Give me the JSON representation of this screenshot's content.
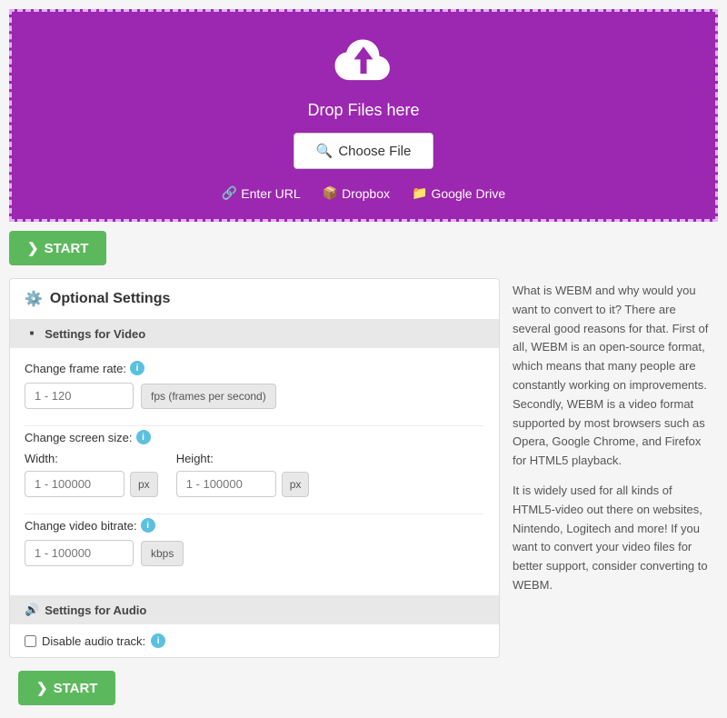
{
  "dropzone": {
    "drop_text": "Drop Files here",
    "choose_file_label": "Choose File",
    "enter_url_label": "Enter URL",
    "dropbox_label": "Dropbox",
    "google_drive_label": "Google Drive",
    "bg_color": "#9c27b0",
    "border_color": "#e0b0ff"
  },
  "start_button": {
    "label": "START"
  },
  "settings": {
    "title": "Optional Settings",
    "video_section": {
      "header": "Settings for Video",
      "frame_rate": {
        "label": "Change frame rate:",
        "placeholder": "1 - 120",
        "unit": "fps (frames per second)"
      },
      "screen_size": {
        "label": "Change screen size:",
        "width_label": "Width:",
        "width_placeholder": "1 - 100000",
        "width_unit": "px",
        "height_label": "Height:",
        "height_placeholder": "1 - 100000",
        "height_unit": "px"
      },
      "bitrate": {
        "label": "Change video bitrate:",
        "placeholder": "1 - 100000",
        "unit": "kbps"
      }
    },
    "audio_section": {
      "header": "Settings for Audio",
      "disable_audio_label": "Disable audio track:"
    }
  },
  "info_panel": {
    "paragraph1": "What is WEBM and why would you want to convert to it? There are several good reasons for that. First of all, WEBM is an open-source format, which means that many people are constantly working on improvements. Secondly, WEBM is a video format supported by most browsers such as Opera, Google Chrome, and Firefox for HTML5 playback.",
    "paragraph2": "It is widely used for all kinds of HTML5-video out there on websites, Nintendo, Logitech and more! If you want to convert your video files for better support, consider converting to WEBM."
  },
  "icons": {
    "gear": "⚙",
    "video": "🎬",
    "audio": "🔊",
    "chevron": "❯",
    "link": "🔗",
    "dropbox": "📦",
    "drive": "📁",
    "search": "🔍",
    "upload_cloud": "☁"
  }
}
